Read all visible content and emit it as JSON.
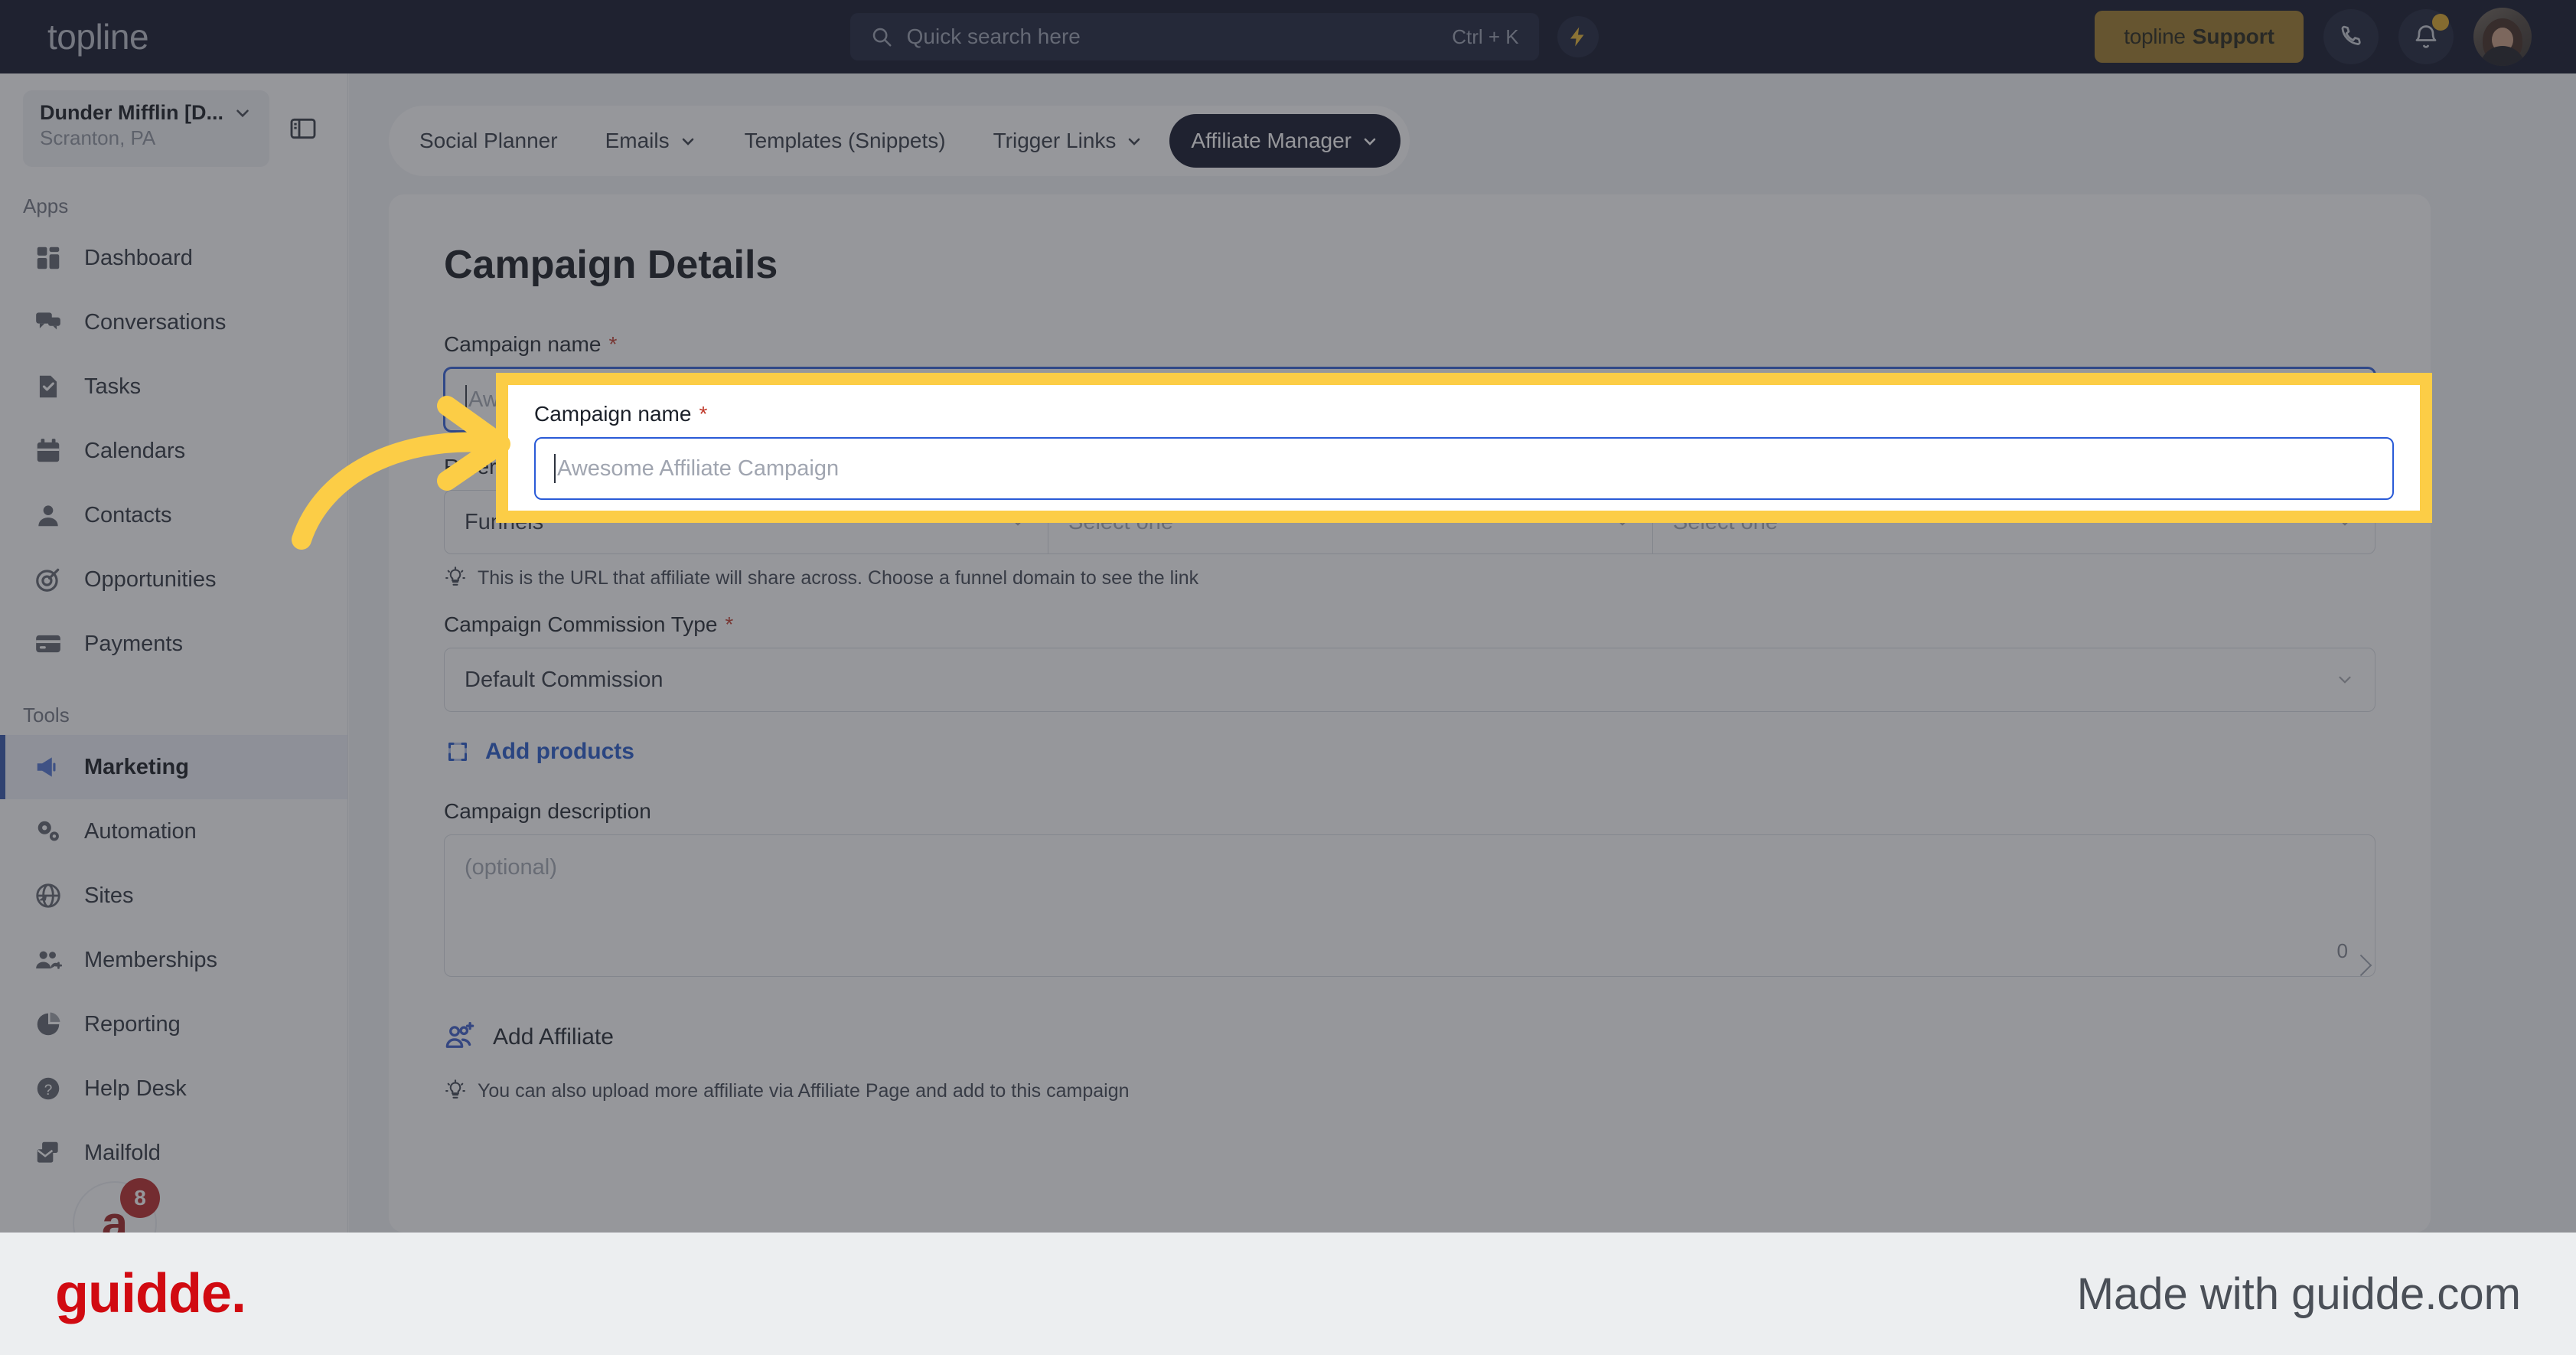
{
  "topbar": {
    "logo": "topline",
    "search_placeholder": "Quick search here",
    "search_shortcut": "Ctrl + K",
    "bolt_icon": "lightning-bolt-icon",
    "support_logo": "topline",
    "support_label": "Support",
    "phone_icon": "phone-icon",
    "bell_icon": "bell-icon"
  },
  "sidebar": {
    "location_name": "Dunder Mifflin [D...",
    "location_sub": "Scranton, PA",
    "panel_toggle_icon": "panel-toggle-icon",
    "apps_label": "Apps",
    "tools_label": "Tools",
    "apps": [
      {
        "label": "Dashboard",
        "icon": "dashboard-icon"
      },
      {
        "label": "Conversations",
        "icon": "chat-bubbles-icon"
      },
      {
        "label": "Tasks",
        "icon": "task-check-icon"
      },
      {
        "label": "Calendars",
        "icon": "calendar-icon"
      },
      {
        "label": "Contacts",
        "icon": "person-icon"
      },
      {
        "label": "Opportunities",
        "icon": "target-icon"
      },
      {
        "label": "Payments",
        "icon": "credit-card-icon"
      }
    ],
    "tools": [
      {
        "label": "Marketing",
        "icon": "megaphone-icon",
        "active": true
      },
      {
        "label": "Automation",
        "icon": "gears-icon",
        "active": false
      },
      {
        "label": "Sites",
        "icon": "globe-icon",
        "active": false
      },
      {
        "label": "Memberships",
        "icon": "people-plus-icon",
        "active": false
      },
      {
        "label": "Reporting",
        "icon": "pie-chart-icon",
        "active": false
      },
      {
        "label": "Help Desk",
        "icon": "question-circle-icon",
        "active": false
      },
      {
        "label": "Mailfold",
        "icon": "mail-stack-icon",
        "active": false
      }
    ],
    "mailfold_badge": "8",
    "mailfold_glyph": "a"
  },
  "tabs": [
    {
      "label": "Social Planner",
      "has_chevron": false,
      "active": false
    },
    {
      "label": "Emails",
      "has_chevron": true,
      "active": false
    },
    {
      "label": "Templates (Snippets)",
      "has_chevron": false,
      "active": false
    },
    {
      "label": "Trigger Links",
      "has_chevron": true,
      "active": false
    },
    {
      "label": "Affiliate Manager",
      "has_chevron": true,
      "active": true
    }
  ],
  "page": {
    "title": "Campaign Details"
  },
  "form": {
    "campaign_name_label": "Campaign name",
    "campaign_name_value": "",
    "campaign_name_placeholder": "Awesome Affiliate Campaign",
    "referral_label": "Referral/lead sign up link",
    "referral_source": "Funnels",
    "referral_second": "Select one",
    "referral_third": "Select one",
    "referral_hint": "This is the URL that affiliate will share across. Choose a funnel domain to see the link",
    "commission_label": "Campaign Commission Type",
    "commission_value": "Default Commission",
    "add_products_label": "Add products",
    "description_label": "Campaign description",
    "description_placeholder": "(optional)",
    "description_count": "0",
    "add_affiliate_label": "Add Affiliate",
    "affiliate_hint": "You can also upload more affiliate via Affiliate Page and add to this campaign",
    "required_mark": "*"
  },
  "annotation": {
    "highlight_color": "#FCCD46",
    "arrow_icon": "curved-arrow-right-icon"
  },
  "footer": {
    "logo": "guidde.",
    "made_with": "Made with guidde.com"
  }
}
